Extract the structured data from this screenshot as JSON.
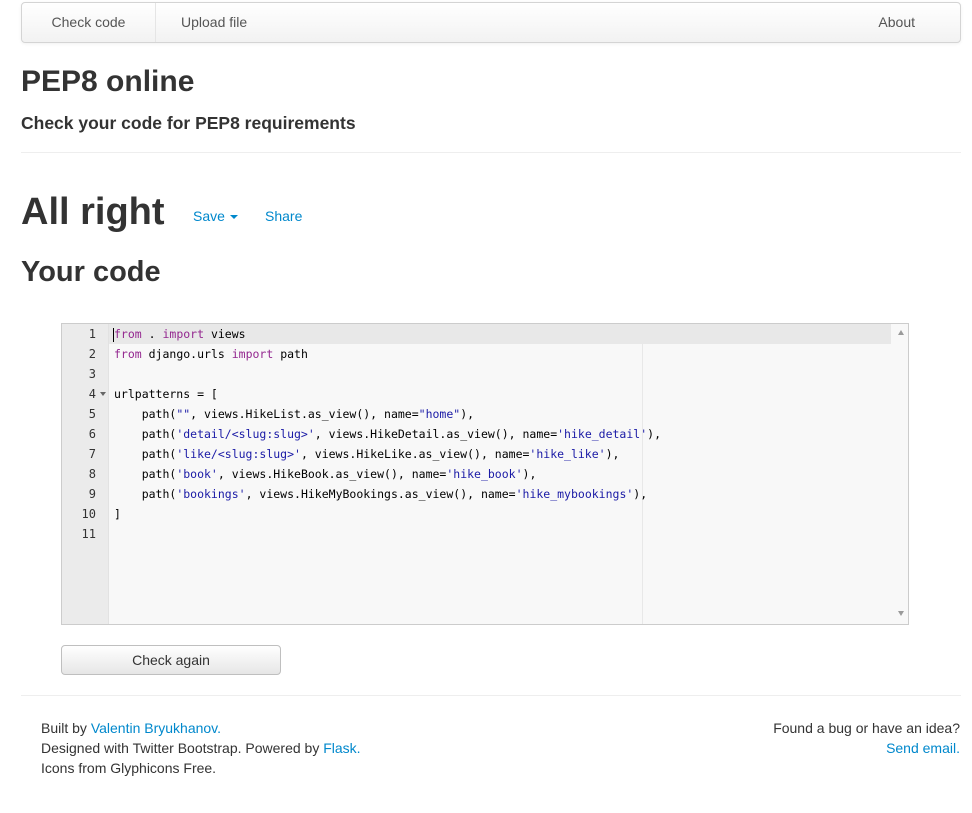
{
  "nav": {
    "check_code": "Check code",
    "upload_file": "Upload file",
    "about": "About"
  },
  "header": {
    "title": "PEP8 online",
    "subtitle": "Check your code for PEP8 requirements"
  },
  "result": {
    "status": "All right",
    "save_label": "Save",
    "share_label": "Share"
  },
  "code_section": {
    "title": "Your code",
    "line_numbers": [
      "1",
      "2",
      "3",
      "4",
      "5",
      "6",
      "7",
      "8",
      "9",
      "10",
      "11"
    ],
    "lines": [
      [
        {
          "t": "from",
          "c": "kw"
        },
        {
          "t": " . ",
          "c": ""
        },
        {
          "t": "import",
          "c": "kw"
        },
        {
          "t": " views",
          "c": ""
        }
      ],
      [
        {
          "t": "from",
          "c": "kw"
        },
        {
          "t": " django.urls ",
          "c": ""
        },
        {
          "t": "import",
          "c": "kw"
        },
        {
          "t": " path",
          "c": ""
        }
      ],
      [],
      [
        {
          "t": "urlpatterns = [",
          "c": ""
        }
      ],
      [
        {
          "t": "    path(",
          "c": ""
        },
        {
          "t": "\"\"",
          "c": "str"
        },
        {
          "t": ", views.HikeList.as_view(), name=",
          "c": ""
        },
        {
          "t": "\"home\"",
          "c": "str"
        },
        {
          "t": "),",
          "c": ""
        }
      ],
      [
        {
          "t": "    path(",
          "c": ""
        },
        {
          "t": "'detail/<slug:slug>'",
          "c": "str"
        },
        {
          "t": ", views.HikeDetail.as_view(), name=",
          "c": ""
        },
        {
          "t": "'hike_detail'",
          "c": "str"
        },
        {
          "t": "),",
          "c": ""
        }
      ],
      [
        {
          "t": "    path(",
          "c": ""
        },
        {
          "t": "'like/<slug:slug>'",
          "c": "str"
        },
        {
          "t": ", views.HikeLike.as_view(), name=",
          "c": ""
        },
        {
          "t": "'hike_like'",
          "c": "str"
        },
        {
          "t": "),",
          "c": ""
        }
      ],
      [
        {
          "t": "    path(",
          "c": ""
        },
        {
          "t": "'book'",
          "c": "str"
        },
        {
          "t": ", views.HikeBook.as_view(), name=",
          "c": ""
        },
        {
          "t": "'hike_book'",
          "c": "str"
        },
        {
          "t": "),",
          "c": ""
        }
      ],
      [
        {
          "t": "    path(",
          "c": ""
        },
        {
          "t": "'bookings'",
          "c": "str"
        },
        {
          "t": ", views.HikeMyBookings.as_view(), name=",
          "c": ""
        },
        {
          "t": "'hike_mybookings'",
          "c": "str"
        },
        {
          "t": "),",
          "c": ""
        }
      ],
      [
        {
          "t": "]",
          "c": ""
        }
      ],
      []
    ]
  },
  "check_again_label": "Check again",
  "footer": {
    "built_by_prefix": "Built by ",
    "author": "Valentin Bryukhanov.",
    "designed_prefix": "Designed with Twitter Bootstrap. Powered by ",
    "flask": "Flask.",
    "icons": "Icons from Glyphicons Free.",
    "bug_text": "Found a bug or have an idea?",
    "send_email": "Send email."
  },
  "colors": {
    "link": "#0088cc",
    "keyword": "#93278f",
    "string": "#1a1aa6"
  }
}
